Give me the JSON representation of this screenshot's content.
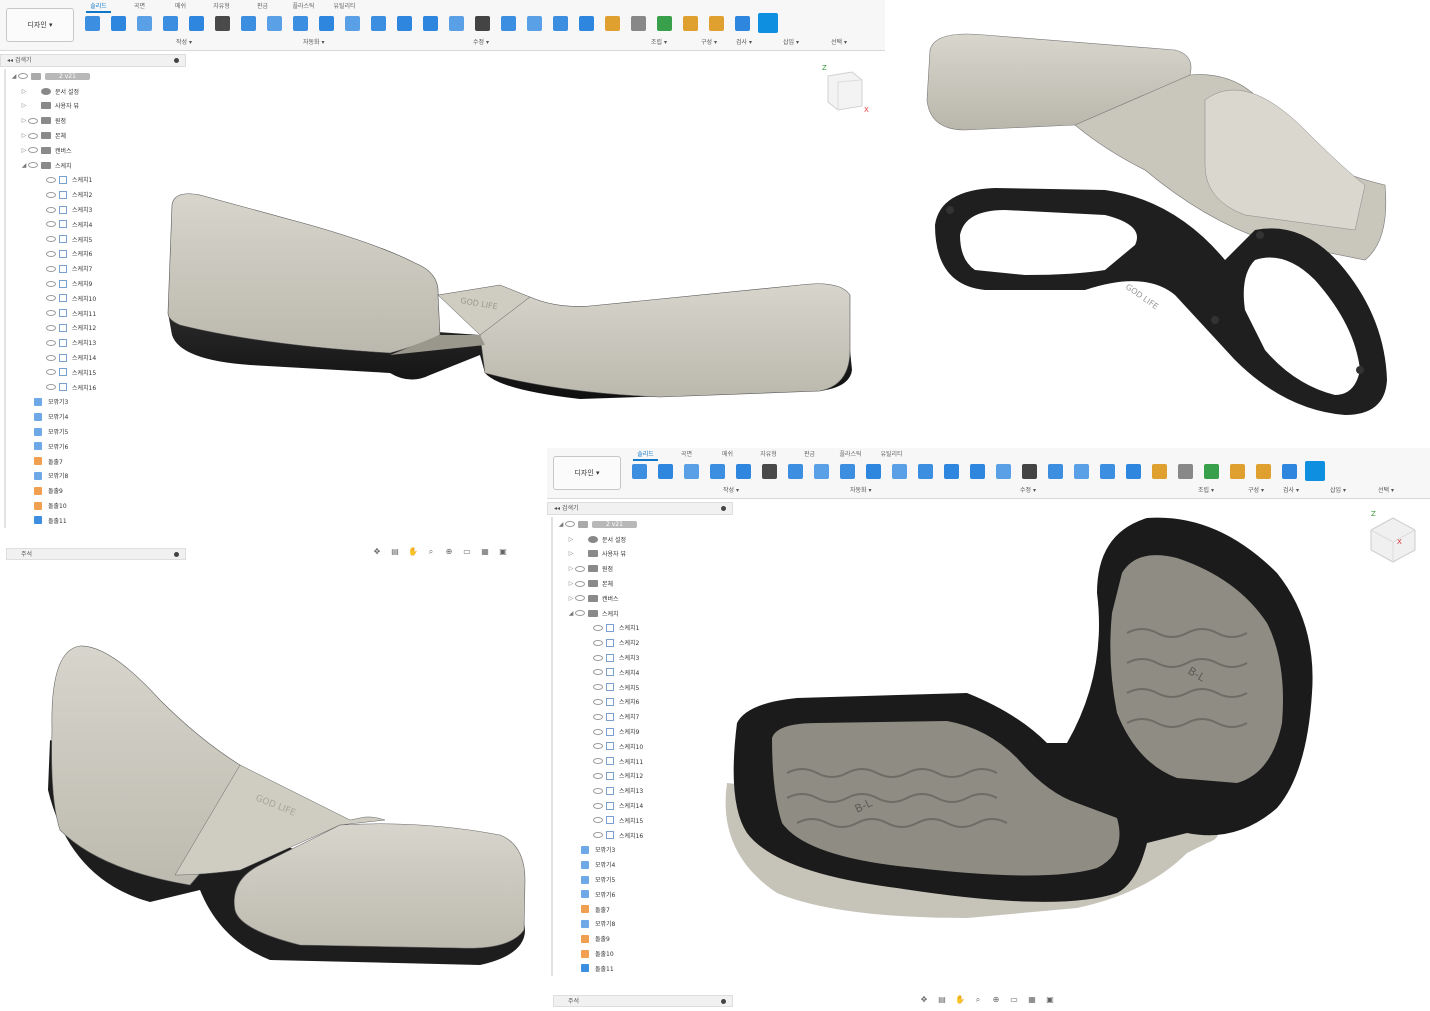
{
  "app": {
    "design_button": "디자인 ▾",
    "tabs": [
      "솔리드",
      "곡면",
      "메쉬",
      "자유형",
      "판금",
      "플라스틱",
      "유틸리티"
    ],
    "active_tab": "솔리드",
    "groups": [
      "작성 ▾",
      "자동화 ▾",
      "수정 ▾",
      "조립 ▾",
      "구성 ▾",
      "검사 ▾",
      "삽입 ▾",
      "선택 ▾"
    ],
    "tool_icons": [
      "sketch-icon",
      "extrude-icon",
      "revolve-icon",
      "pattern-icon",
      "sweep-icon",
      "loft-icon",
      "hole-icon",
      "thicken-icon",
      "automate-icon",
      "press-pull-icon",
      "fillet-icon",
      "chamfer-icon",
      "shell-icon",
      "combine-icon",
      "split-icon",
      "move-icon",
      "scale-icon",
      "draft-icon",
      "replace-face-icon",
      "align-icon",
      "new-component-icon",
      "joint-icon",
      "plane-icon",
      "measure-icon",
      "insert-mesh-icon",
      "decal-icon",
      "select-icon"
    ]
  },
  "browser": {
    "title": "검색기",
    "root_label": "2 v21",
    "items": [
      {
        "label": "문서 설정",
        "kind": "gear",
        "tri": "▷",
        "eye": false
      },
      {
        "label": "사용자 뷰",
        "kind": "folder",
        "tri": "▷",
        "eye": false
      },
      {
        "label": "원점",
        "kind": "folder",
        "tri": "▷",
        "eye": true
      },
      {
        "label": "본체",
        "kind": "folder",
        "tri": "▷",
        "eye": true
      },
      {
        "label": "캔버스",
        "kind": "folder",
        "tri": "▷",
        "eye": true
      },
      {
        "label": "스케치",
        "kind": "folder",
        "tri": "◢",
        "eye": true
      }
    ],
    "sketches": [
      "스케치1",
      "스케치2",
      "스케치3",
      "스케치4",
      "스케치5",
      "스케치6",
      "스케치7",
      "스케치9",
      "스케치10",
      "스케치11",
      "스케치12",
      "스케치13",
      "스케치14",
      "스케치15",
      "스케치16"
    ],
    "bodies": [
      {
        "label": "모깎기3",
        "color": "#6fa8e6"
      },
      {
        "label": "모깎기4",
        "color": "#6fa8e6"
      },
      {
        "label": "모깎기5",
        "color": "#6fa8e6"
      },
      {
        "label": "모깎기6",
        "color": "#6fa8e6"
      },
      {
        "label": "돌출7",
        "color": "#f0a050"
      },
      {
        "label": "모깎기8",
        "color": "#6fa8e6"
      },
      {
        "label": "돌출9",
        "color": "#f0a050"
      },
      {
        "label": "돌출10",
        "color": "#f0a050"
      },
      {
        "label": "돌출11",
        "color": "#3c8fe0"
      }
    ],
    "comment_label": "주석"
  },
  "viewcube": {
    "z": "Z",
    "x": "X",
    "front": "앞면도",
    "right": "오른쪽"
  },
  "model": {
    "engraving": "GOD LIFE",
    "logo": "B-L"
  },
  "colors": {
    "accent": "#0f77c9",
    "body_gray": "#c9c6bb",
    "black": "#1e1e1e"
  }
}
